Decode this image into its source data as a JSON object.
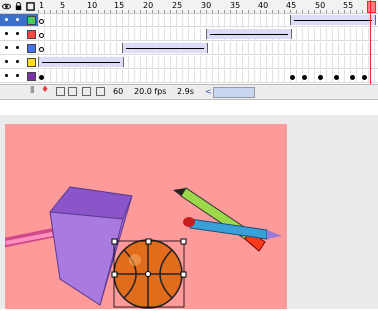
{
  "timeline": {
    "frame_numbers": [
      "1",
      "5",
      "10",
      "15",
      "20",
      "25",
      "30",
      "35",
      "40",
      "45",
      "50",
      "55"
    ],
    "layers": [
      {
        "color": "#44cc66",
        "selected": true
      },
      {
        "color": "#ff4444",
        "selected": false
      },
      {
        "color": "#4477ee",
        "selected": false
      },
      {
        "color": "#ffdd22",
        "selected": false
      },
      {
        "color": "#7733aa",
        "selected": false
      }
    ],
    "current_frame": "60",
    "frame_rate": "20.0 fps",
    "elapsed_time": "2.9s"
  },
  "stage": {
    "background_color": "#ff9a9a",
    "objects": [
      "pencil-cup",
      "pencil",
      "pencil",
      "basketball",
      "pencil"
    ]
  }
}
